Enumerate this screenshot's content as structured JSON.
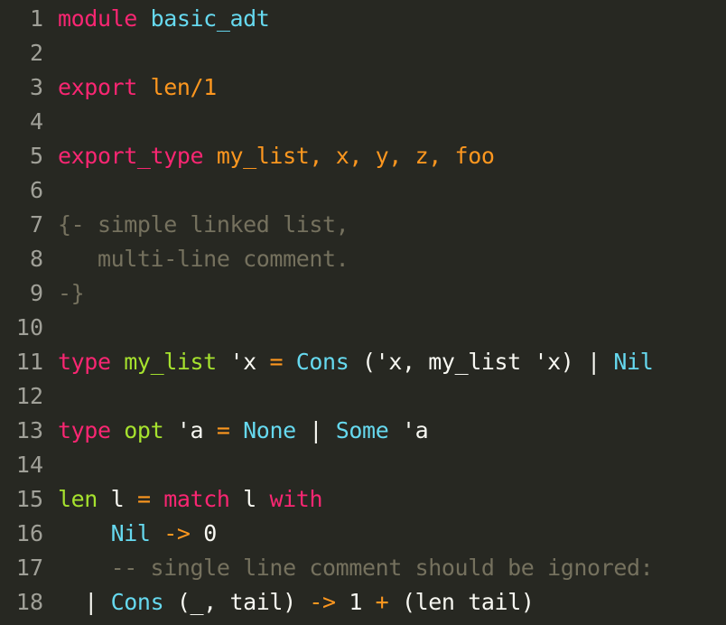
{
  "editor": {
    "lines": [
      {
        "n": "1",
        "tokens": [
          {
            "t": "module",
            "c": "kw"
          },
          {
            "t": " ",
            "c": "plain"
          },
          {
            "t": "basic_adt",
            "c": "name"
          }
        ]
      },
      {
        "n": "2",
        "tokens": []
      },
      {
        "n": "3",
        "tokens": [
          {
            "t": "export",
            "c": "kw"
          },
          {
            "t": " ",
            "c": "plain"
          },
          {
            "t": "len/1",
            "c": "op"
          }
        ]
      },
      {
        "n": "4",
        "tokens": []
      },
      {
        "n": "5",
        "tokens": [
          {
            "t": "export_type",
            "c": "kw"
          },
          {
            "t": " ",
            "c": "plain"
          },
          {
            "t": "my_list, x, y, z, foo",
            "c": "op"
          }
        ]
      },
      {
        "n": "6",
        "tokens": []
      },
      {
        "n": "7",
        "tokens": [
          {
            "t": "{- simple linked list,",
            "c": "comment"
          }
        ]
      },
      {
        "n": "8",
        "tokens": [
          {
            "t": "   multi-line comment.",
            "c": "comment"
          }
        ]
      },
      {
        "n": "9",
        "tokens": [
          {
            "t": "-}",
            "c": "comment"
          }
        ]
      },
      {
        "n": "10",
        "tokens": []
      },
      {
        "n": "11",
        "tokens": [
          {
            "t": "type",
            "c": "kw"
          },
          {
            "t": " ",
            "c": "plain"
          },
          {
            "t": "my_list",
            "c": "fn"
          },
          {
            "t": " 'x ",
            "c": "plain"
          },
          {
            "t": "=",
            "c": "op"
          },
          {
            "t": " ",
            "c": "plain"
          },
          {
            "t": "Cons",
            "c": "ctor"
          },
          {
            "t": " ('x, my_list 'x) | ",
            "c": "plain"
          },
          {
            "t": "Nil",
            "c": "ctor"
          }
        ]
      },
      {
        "n": "12",
        "tokens": []
      },
      {
        "n": "13",
        "tokens": [
          {
            "t": "type",
            "c": "kw"
          },
          {
            "t": " ",
            "c": "plain"
          },
          {
            "t": "opt",
            "c": "fn"
          },
          {
            "t": " 'a ",
            "c": "plain"
          },
          {
            "t": "=",
            "c": "op"
          },
          {
            "t": " ",
            "c": "plain"
          },
          {
            "t": "None",
            "c": "ctor"
          },
          {
            "t": " | ",
            "c": "plain"
          },
          {
            "t": "Some",
            "c": "ctor"
          },
          {
            "t": " 'a",
            "c": "plain"
          }
        ]
      },
      {
        "n": "14",
        "tokens": []
      },
      {
        "n": "15",
        "tokens": [
          {
            "t": "len",
            "c": "fn"
          },
          {
            "t": " l ",
            "c": "plain"
          },
          {
            "t": "=",
            "c": "op"
          },
          {
            "t": " ",
            "c": "plain"
          },
          {
            "t": "match",
            "c": "kw"
          },
          {
            "t": " l ",
            "c": "plain"
          },
          {
            "t": "with",
            "c": "kw"
          }
        ]
      },
      {
        "n": "16",
        "tokens": [
          {
            "t": "    ",
            "c": "plain"
          },
          {
            "t": "Nil",
            "c": "ctor"
          },
          {
            "t": " ",
            "c": "plain"
          },
          {
            "t": "->",
            "c": "op"
          },
          {
            "t": " 0",
            "c": "plain"
          }
        ]
      },
      {
        "n": "17",
        "tokens": [
          {
            "t": "    -- single line comment should be ignored:",
            "c": "comment"
          }
        ]
      },
      {
        "n": "18",
        "tokens": [
          {
            "t": "  | ",
            "c": "plain"
          },
          {
            "t": "Cons",
            "c": "ctor"
          },
          {
            "t": " (_, tail) ",
            "c": "plain"
          },
          {
            "t": "->",
            "c": "op"
          },
          {
            "t": " 1 ",
            "c": "plain"
          },
          {
            "t": "+",
            "c": "op"
          },
          {
            "t": " (len tail)",
            "c": "plain"
          }
        ]
      }
    ]
  }
}
